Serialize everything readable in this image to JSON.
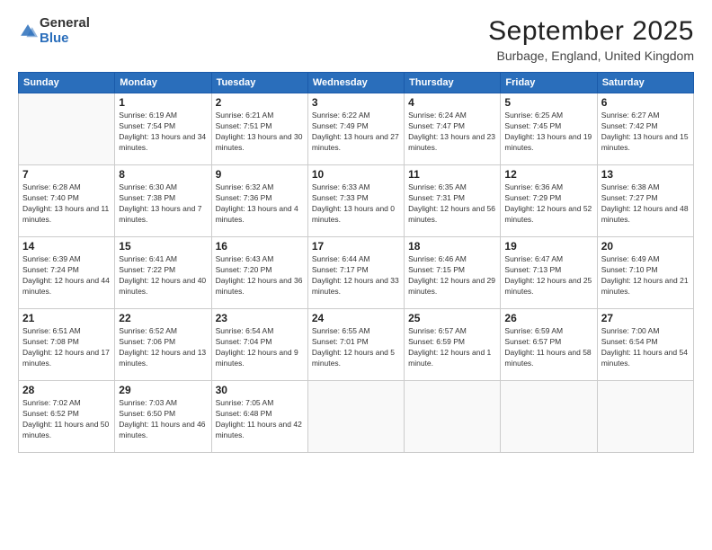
{
  "header": {
    "logo_general": "General",
    "logo_blue": "Blue",
    "month_title": "September 2025",
    "location": "Burbage, England, United Kingdom"
  },
  "days_of_week": [
    "Sunday",
    "Monday",
    "Tuesday",
    "Wednesday",
    "Thursday",
    "Friday",
    "Saturday"
  ],
  "weeks": [
    [
      {
        "day": "",
        "sunrise": "",
        "sunset": "",
        "daylight": ""
      },
      {
        "day": "1",
        "sunrise": "Sunrise: 6:19 AM",
        "sunset": "Sunset: 7:54 PM",
        "daylight": "Daylight: 13 hours and 34 minutes."
      },
      {
        "day": "2",
        "sunrise": "Sunrise: 6:21 AM",
        "sunset": "Sunset: 7:51 PM",
        "daylight": "Daylight: 13 hours and 30 minutes."
      },
      {
        "day": "3",
        "sunrise": "Sunrise: 6:22 AM",
        "sunset": "Sunset: 7:49 PM",
        "daylight": "Daylight: 13 hours and 27 minutes."
      },
      {
        "day": "4",
        "sunrise": "Sunrise: 6:24 AM",
        "sunset": "Sunset: 7:47 PM",
        "daylight": "Daylight: 13 hours and 23 minutes."
      },
      {
        "day": "5",
        "sunrise": "Sunrise: 6:25 AM",
        "sunset": "Sunset: 7:45 PM",
        "daylight": "Daylight: 13 hours and 19 minutes."
      },
      {
        "day": "6",
        "sunrise": "Sunrise: 6:27 AM",
        "sunset": "Sunset: 7:42 PM",
        "daylight": "Daylight: 13 hours and 15 minutes."
      }
    ],
    [
      {
        "day": "7",
        "sunrise": "Sunrise: 6:28 AM",
        "sunset": "Sunset: 7:40 PM",
        "daylight": "Daylight: 13 hours and 11 minutes."
      },
      {
        "day": "8",
        "sunrise": "Sunrise: 6:30 AM",
        "sunset": "Sunset: 7:38 PM",
        "daylight": "Daylight: 13 hours and 7 minutes."
      },
      {
        "day": "9",
        "sunrise": "Sunrise: 6:32 AM",
        "sunset": "Sunset: 7:36 PM",
        "daylight": "Daylight: 13 hours and 4 minutes."
      },
      {
        "day": "10",
        "sunrise": "Sunrise: 6:33 AM",
        "sunset": "Sunset: 7:33 PM",
        "daylight": "Daylight: 13 hours and 0 minutes."
      },
      {
        "day": "11",
        "sunrise": "Sunrise: 6:35 AM",
        "sunset": "Sunset: 7:31 PM",
        "daylight": "Daylight: 12 hours and 56 minutes."
      },
      {
        "day": "12",
        "sunrise": "Sunrise: 6:36 AM",
        "sunset": "Sunset: 7:29 PM",
        "daylight": "Daylight: 12 hours and 52 minutes."
      },
      {
        "day": "13",
        "sunrise": "Sunrise: 6:38 AM",
        "sunset": "Sunset: 7:27 PM",
        "daylight": "Daylight: 12 hours and 48 minutes."
      }
    ],
    [
      {
        "day": "14",
        "sunrise": "Sunrise: 6:39 AM",
        "sunset": "Sunset: 7:24 PM",
        "daylight": "Daylight: 12 hours and 44 minutes."
      },
      {
        "day": "15",
        "sunrise": "Sunrise: 6:41 AM",
        "sunset": "Sunset: 7:22 PM",
        "daylight": "Daylight: 12 hours and 40 minutes."
      },
      {
        "day": "16",
        "sunrise": "Sunrise: 6:43 AM",
        "sunset": "Sunset: 7:20 PM",
        "daylight": "Daylight: 12 hours and 36 minutes."
      },
      {
        "day": "17",
        "sunrise": "Sunrise: 6:44 AM",
        "sunset": "Sunset: 7:17 PM",
        "daylight": "Daylight: 12 hours and 33 minutes."
      },
      {
        "day": "18",
        "sunrise": "Sunrise: 6:46 AM",
        "sunset": "Sunset: 7:15 PM",
        "daylight": "Daylight: 12 hours and 29 minutes."
      },
      {
        "day": "19",
        "sunrise": "Sunrise: 6:47 AM",
        "sunset": "Sunset: 7:13 PM",
        "daylight": "Daylight: 12 hours and 25 minutes."
      },
      {
        "day": "20",
        "sunrise": "Sunrise: 6:49 AM",
        "sunset": "Sunset: 7:10 PM",
        "daylight": "Daylight: 12 hours and 21 minutes."
      }
    ],
    [
      {
        "day": "21",
        "sunrise": "Sunrise: 6:51 AM",
        "sunset": "Sunset: 7:08 PM",
        "daylight": "Daylight: 12 hours and 17 minutes."
      },
      {
        "day": "22",
        "sunrise": "Sunrise: 6:52 AM",
        "sunset": "Sunset: 7:06 PM",
        "daylight": "Daylight: 12 hours and 13 minutes."
      },
      {
        "day": "23",
        "sunrise": "Sunrise: 6:54 AM",
        "sunset": "Sunset: 7:04 PM",
        "daylight": "Daylight: 12 hours and 9 minutes."
      },
      {
        "day": "24",
        "sunrise": "Sunrise: 6:55 AM",
        "sunset": "Sunset: 7:01 PM",
        "daylight": "Daylight: 12 hours and 5 minutes."
      },
      {
        "day": "25",
        "sunrise": "Sunrise: 6:57 AM",
        "sunset": "Sunset: 6:59 PM",
        "daylight": "Daylight: 12 hours and 1 minute."
      },
      {
        "day": "26",
        "sunrise": "Sunrise: 6:59 AM",
        "sunset": "Sunset: 6:57 PM",
        "daylight": "Daylight: 11 hours and 58 minutes."
      },
      {
        "day": "27",
        "sunrise": "Sunrise: 7:00 AM",
        "sunset": "Sunset: 6:54 PM",
        "daylight": "Daylight: 11 hours and 54 minutes."
      }
    ],
    [
      {
        "day": "28",
        "sunrise": "Sunrise: 7:02 AM",
        "sunset": "Sunset: 6:52 PM",
        "daylight": "Daylight: 11 hours and 50 minutes."
      },
      {
        "day": "29",
        "sunrise": "Sunrise: 7:03 AM",
        "sunset": "Sunset: 6:50 PM",
        "daylight": "Daylight: 11 hours and 46 minutes."
      },
      {
        "day": "30",
        "sunrise": "Sunrise: 7:05 AM",
        "sunset": "Sunset: 6:48 PM",
        "daylight": "Daylight: 11 hours and 42 minutes."
      },
      {
        "day": "",
        "sunrise": "",
        "sunset": "",
        "daylight": ""
      },
      {
        "day": "",
        "sunrise": "",
        "sunset": "",
        "daylight": ""
      },
      {
        "day": "",
        "sunrise": "",
        "sunset": "",
        "daylight": ""
      },
      {
        "day": "",
        "sunrise": "",
        "sunset": "",
        "daylight": ""
      }
    ]
  ]
}
